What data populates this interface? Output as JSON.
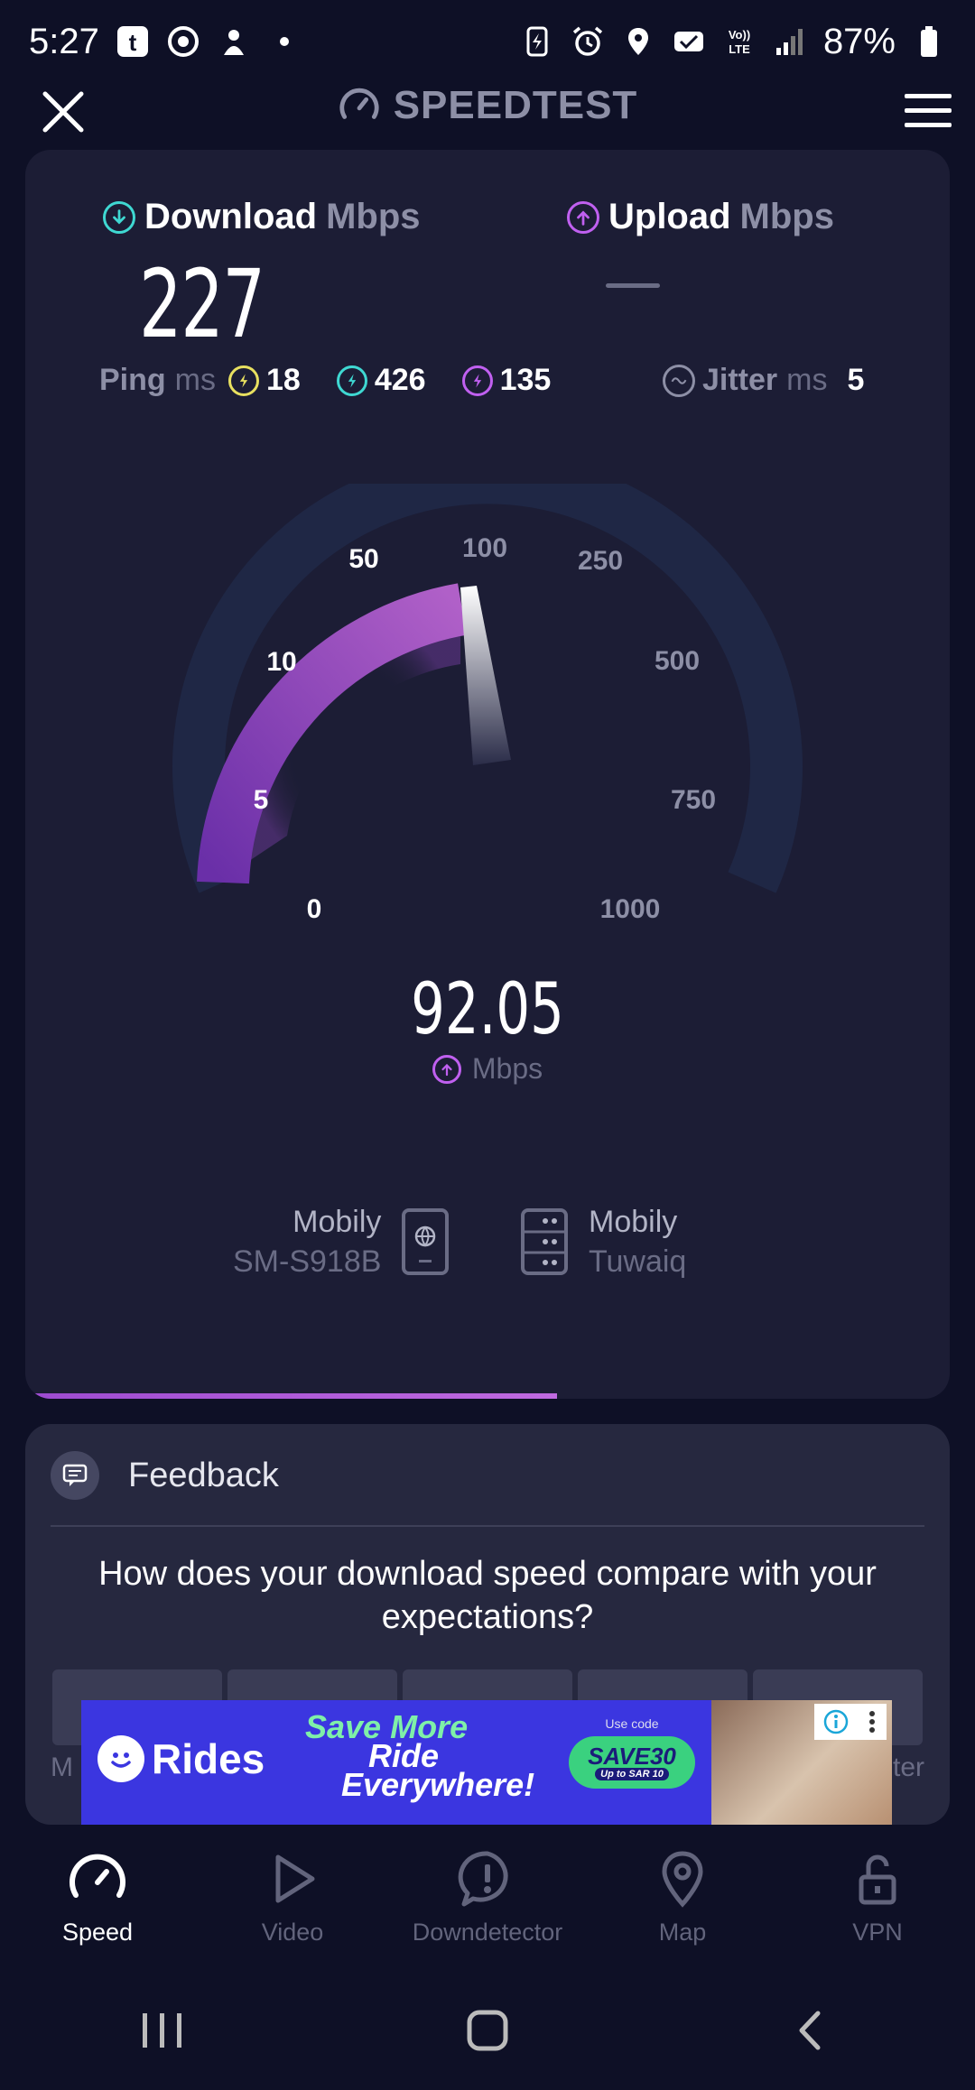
{
  "status_bar": {
    "time": "5:27",
    "battery": "87%",
    "network": "Vo)) LTE"
  },
  "header": {
    "brand": "SPEEDTEST"
  },
  "results": {
    "download": {
      "label": "Download",
      "unit": "Mbps",
      "value": "227"
    },
    "upload": {
      "label": "Upload",
      "unit": "Mbps",
      "value": ""
    },
    "ping": {
      "label": "Ping",
      "unit": "ms",
      "idle": "18",
      "download": "426",
      "upload": "135"
    },
    "jitter": {
      "label": "Jitter",
      "unit": "ms",
      "value": "5"
    }
  },
  "gauge": {
    "scale_labels": [
      "0",
      "5",
      "10",
      "50",
      "100",
      "250",
      "500",
      "750",
      "1000"
    ],
    "current_value": "92.05",
    "current_unit": "Mbps",
    "mode": "upload"
  },
  "servers": {
    "client": {
      "provider": "Mobily",
      "device": "SM-S918B"
    },
    "host": {
      "provider": "Mobily",
      "location": "Tuwaiq"
    }
  },
  "progress": 0.575,
  "feedback": {
    "title": "Feedback",
    "question": "How does your download speed compare with your expectations?",
    "left_label": "M",
    "right_label": "ter"
  },
  "ad": {
    "brand": "Rides",
    "headline_1": "Save More",
    "headline_2": "Ride",
    "headline_3": "Everywhere!",
    "code_label": "Use code",
    "code": "SAVE30",
    "code_sub": "Up to SAR 10"
  },
  "bottom_nav": [
    {
      "label": "Speed",
      "icon": "speedometer-icon",
      "active": true
    },
    {
      "label": "Video",
      "icon": "play-icon",
      "active": false
    },
    {
      "label": "Downdetector",
      "icon": "alert-icon",
      "active": false
    },
    {
      "label": "Map",
      "icon": "map-pin-icon",
      "active": false
    },
    {
      "label": "VPN",
      "icon": "unlock-icon",
      "active": false
    }
  ],
  "colors": {
    "background": "#0e1026",
    "card": "#1c1d35",
    "download_accent": "#3fd8d2",
    "upload_accent": "#c060f0",
    "ping_accent": "#e8e060",
    "gauge_fill": "#9b4fc8",
    "gauge_track": "#1f2745"
  }
}
